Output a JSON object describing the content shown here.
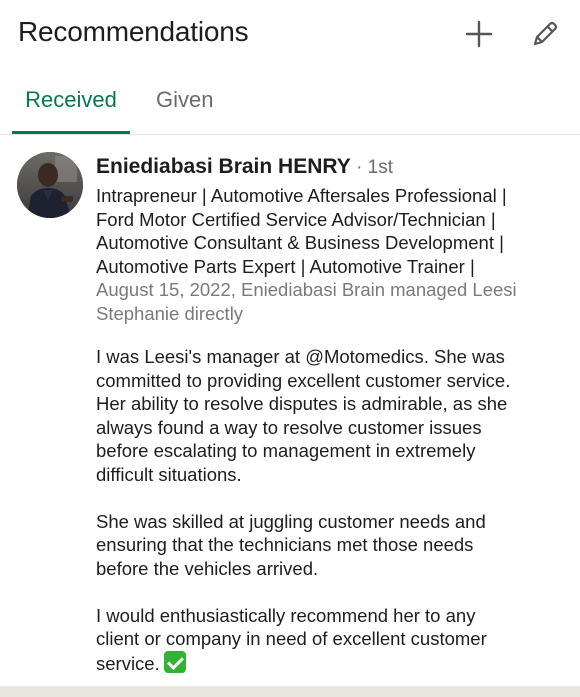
{
  "header": {
    "title": "Recommendations",
    "add_icon": "plus-icon",
    "edit_icon": "pencil-icon"
  },
  "tabs": [
    {
      "label": "Received",
      "active": true
    },
    {
      "label": "Given",
      "active": false
    }
  ],
  "recommendation": {
    "name": "Eniediabasi Brain HENRY",
    "degree": " · 1st",
    "headline_lines": [
      "Intrapreneur | Automotive Aftersales Professional |",
      "Ford Motor Certified Service Advisor/Technician |",
      "Automotive Consultant & Business Development |",
      "Automotive Parts Expert | Automotive Trainer |"
    ],
    "meta_lines": [
      "August 15, 2022, Eniediabasi Brain managed Leesi",
      "Stephanie directly"
    ],
    "paragraph_1_lines": [
      "I was Leesi's manager at @Motomedics. She was",
      "committed to providing excellent customer service.",
      "Her ability to resolve disputes is admirable, as she",
      "always found a way to resolve customer issues",
      "before escalating to management in extremely",
      "difficult situations."
    ],
    "paragraph_2_lines": [
      "She was skilled at juggling customer needs and",
      "ensuring that the technicians met those needs",
      "before the vehicles arrived."
    ],
    "paragraph_3_lines": [
      "I would enthusiastically recommend her to any",
      "client or company in need of excellent customer",
      "service."
    ],
    "emoji_icon": "check-mark-emoji-icon"
  },
  "colors": {
    "accent": "#047a4a",
    "text": "#1d1d1d",
    "muted": "#6b6b6b",
    "footer": "#e9e5df"
  }
}
